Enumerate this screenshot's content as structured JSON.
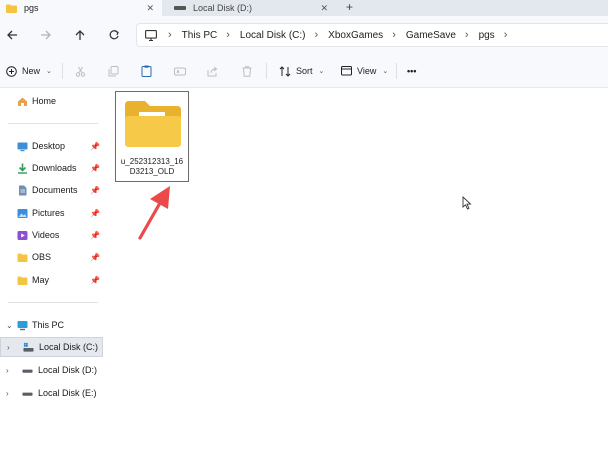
{
  "tabs": [
    {
      "label": "pgs",
      "close": "✕",
      "active": true
    },
    {
      "label": "Local Disk (D:)",
      "close": "✕",
      "active": false
    }
  ],
  "new_tab_symbol": "+",
  "nav": {
    "back_icon": "arrow-left-icon",
    "forward_icon": "arrow-right-icon",
    "up_icon": "arrow-up-icon",
    "refresh_icon": "refresh-icon"
  },
  "breadcrumb": [
    "This PC",
    "Local Disk (C:)",
    "XboxGames",
    "GameSave",
    "pgs"
  ],
  "commands": {
    "new_label": "New",
    "sort_label": "Sort",
    "view_label": "View",
    "more_label": "•••"
  },
  "sidebar": {
    "home": "Home",
    "quick_access": [
      {
        "label": "Desktop",
        "icon": "desktop-icon"
      },
      {
        "label": "Downloads",
        "icon": "downloads-icon"
      },
      {
        "label": "Documents",
        "icon": "documents-icon"
      },
      {
        "label": "Pictures",
        "icon": "pictures-icon"
      },
      {
        "label": "Videos",
        "icon": "videos-icon"
      },
      {
        "label": "OBS",
        "icon": "folder-icon"
      },
      {
        "label": "May",
        "icon": "folder-icon"
      }
    ],
    "this_pc": "This PC",
    "drives": [
      {
        "label": "Local Disk (C:)",
        "selected": true
      },
      {
        "label": "Local Disk (D:)",
        "selected": false
      },
      {
        "label": "Local Disk (E:)",
        "selected": false
      }
    ]
  },
  "content": {
    "items": [
      {
        "name": "u_252312313_16D3213_OLD",
        "type": "folder"
      }
    ]
  },
  "colors": {
    "folder": "#f5c542",
    "annotation_arrow": "#ec4a4a",
    "selected_bg": "#e5e9ef",
    "chrome_bg": "#f7f9fc"
  }
}
